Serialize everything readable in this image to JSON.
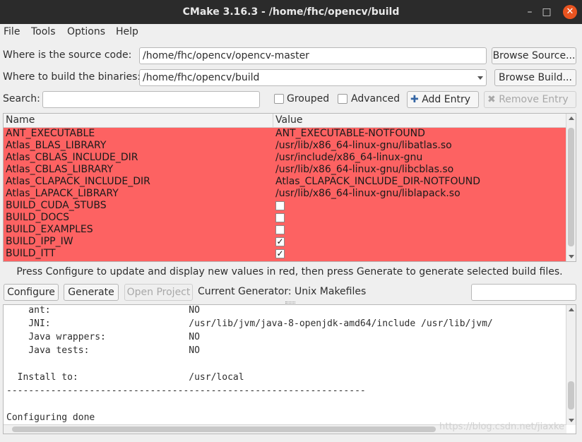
{
  "window": {
    "title": "CMake 3.16.3 - /home/fhc/opencv/build",
    "min_glyph": "–",
    "max_glyph": "□",
    "close_glyph": "✕"
  },
  "menu": [
    {
      "label": "File"
    },
    {
      "label": "Tools"
    },
    {
      "label": "Options"
    },
    {
      "label": "Help"
    }
  ],
  "source": {
    "label": "Where is the source code:",
    "value": "/home/fhc/opencv/opencv-master",
    "browse": "Browse Source..."
  },
  "build": {
    "label": "Where to build the binaries:",
    "value": "/home/fhc/opencv/build",
    "browse": "Browse Build..."
  },
  "search": {
    "label": "Search:",
    "value": ""
  },
  "options": {
    "grouped": "Grouped",
    "advanced": "Advanced",
    "add_entry": "Add Entry",
    "remove_entry": "Remove Entry"
  },
  "table": {
    "columns": [
      "Name",
      "Value"
    ],
    "highlight_color": "#fd6262",
    "rows": [
      {
        "name": "ANT_EXECUTABLE",
        "value": "ANT_EXECUTABLE-NOTFOUND"
      },
      {
        "name": "Atlas_BLAS_LIBRARY",
        "value": "/usr/lib/x86_64-linux-gnu/libatlas.so"
      },
      {
        "name": "Atlas_CBLAS_INCLUDE_DIR",
        "value": "/usr/include/x86_64-linux-gnu"
      },
      {
        "name": "Atlas_CBLAS_LIBRARY",
        "value": "/usr/lib/x86_64-linux-gnu/libcblas.so"
      },
      {
        "name": "Atlas_CLAPACK_INCLUDE_DIR",
        "value": "Atlas_CLAPACK_INCLUDE_DIR-NOTFOUND"
      },
      {
        "name": "Atlas_LAPACK_LIBRARY",
        "value": "/usr/lib/x86_64-linux-gnu/liblapack.so"
      },
      {
        "name": "BUILD_CUDA_STUBS",
        "check": ""
      },
      {
        "name": "BUILD_DOCS",
        "check": ""
      },
      {
        "name": "BUILD_EXAMPLES",
        "check": ""
      },
      {
        "name": "BUILD_IPP_IW",
        "check": "✓"
      },
      {
        "name": "BUILD_ITT",
        "check": "✓"
      }
    ]
  },
  "hint": "Press Configure to update and display new values in red, then press Generate to generate selected build files.",
  "actions": {
    "configure": "Configure",
    "generate": "Generate",
    "open_project": "Open Project",
    "generator": "Current Generator: Unix Makefiles"
  },
  "output": {
    "lines": [
      "    ant:                         NO",
      "    JNI:                         /usr/lib/jvm/java-8-openjdk-amd64/include /usr/lib/jvm/",
      "    Java wrappers:               NO",
      "    Java tests:                  NO",
      "",
      "  Install to:                    /usr/local",
      "-----------------------------------------------------------------",
      "",
      "",
      "Configuring done"
    ]
  },
  "watermark": "https://blog.csdn.net/jiaxke"
}
